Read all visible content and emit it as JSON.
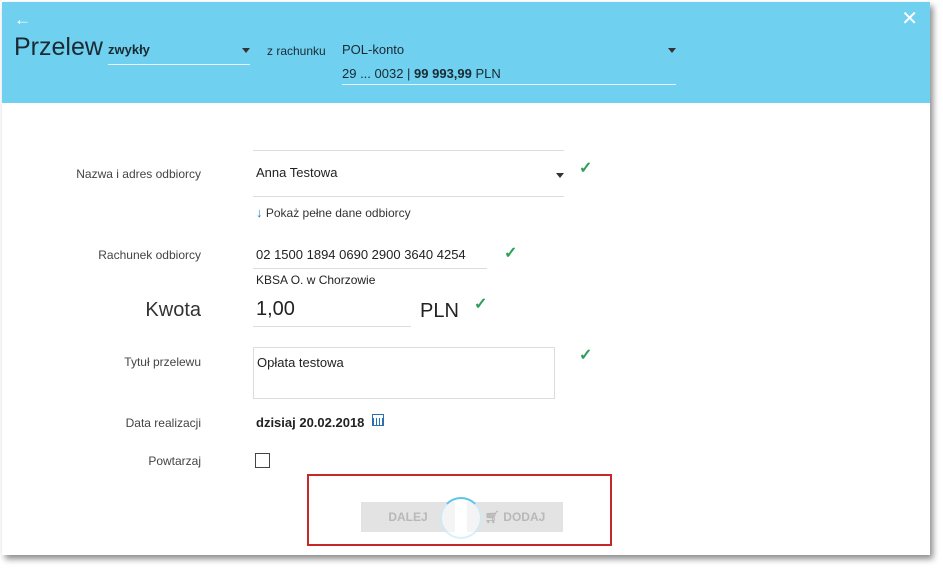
{
  "header": {
    "back_icon": "←",
    "close_icon": "✕",
    "title": "Przelew",
    "type_select": "zwykły",
    "from_account_label": "z rachunku",
    "account_name": "POL-konto",
    "account_number": "29 ... 0032 | ",
    "account_balance": "99 993,99",
    "account_currency": "PLN"
  },
  "form": {
    "recipient": {
      "label": "Nazwa i adres odbiorcy",
      "value": "Anna Testowa",
      "show_full_link": "Pokaż pełne dane odbiorcy"
    },
    "account": {
      "label": "Rachunek odbiorcy",
      "value": "02 1500 1894 0690 2900 3640 4254",
      "bank": "KBSA O. w Chorzowie"
    },
    "amount": {
      "label": "Kwota",
      "value": "1,00",
      "currency": "PLN"
    },
    "title": {
      "label": "Tytuł przelewu",
      "value": "Opłata testowa"
    },
    "date": {
      "label": "Data realizacji",
      "value": "dzisiaj 20.02.2018"
    },
    "repeat": {
      "label": "Powtarzaj",
      "checked": false
    }
  },
  "buttons": {
    "next": "DALEJ",
    "add": "DODAJ"
  },
  "colors": {
    "header_bg": "#6fd0f0",
    "check": "#2e9e5b",
    "highlight": "#c62828"
  }
}
